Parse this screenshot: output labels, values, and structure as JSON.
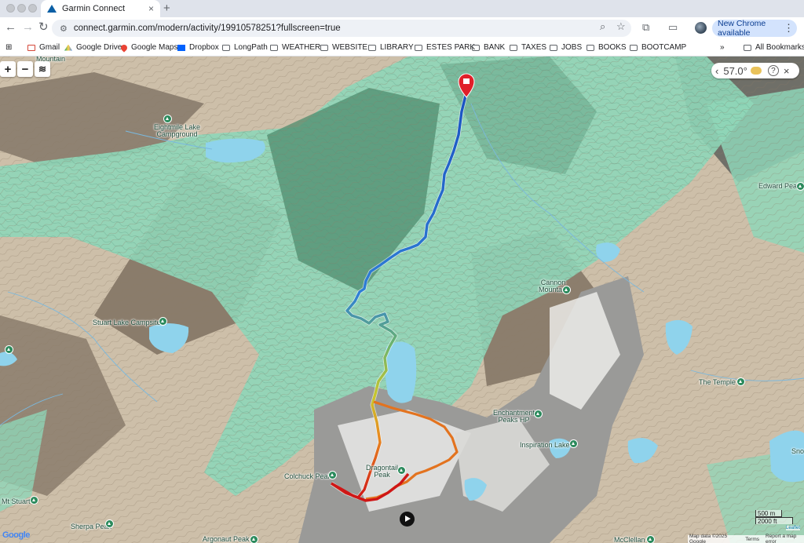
{
  "browser": {
    "tab_title": "Garmin Connect",
    "tab_close": "×",
    "new_tab": "+",
    "url": "connect.garmin.com/modern/activity/19910578251?fullscreen=true",
    "update_button": "New Chrome available",
    "more_menu": "⋮"
  },
  "bookmarks": [
    {
      "label": "Gmail",
      "icon": "gmail-icon"
    },
    {
      "label": "Google Drive",
      "icon": "google-drive-icon"
    },
    {
      "label": "Google Maps",
      "icon": "google-maps-icon"
    },
    {
      "label": "Dropbox",
      "icon": "dropbox-icon"
    },
    {
      "label": "LongPath",
      "icon": "folder-icon"
    },
    {
      "label": "WEATHER",
      "icon": "folder-icon"
    },
    {
      "label": "WEBSITE",
      "icon": "folder-icon"
    },
    {
      "label": "LIBRARY",
      "icon": "folder-icon"
    },
    {
      "label": "ESTES PARK",
      "icon": "folder-icon"
    },
    {
      "label": "BANK",
      "icon": "folder-icon"
    },
    {
      "label": "TAXES",
      "icon": "folder-icon"
    },
    {
      "label": "JOBS",
      "icon": "folder-icon"
    },
    {
      "label": "BOOKS",
      "icon": "folder-icon"
    },
    {
      "label": "BOOTCAMP",
      "icon": "folder-icon"
    }
  ],
  "bookmarks_overflow": "»",
  "all_bookmarks": "All Bookmarks",
  "map": {
    "zoom_in": "+",
    "zoom_out": "−",
    "weather": {
      "temperature": "57.0°",
      "prev": "‹",
      "help": "?",
      "close": "×"
    },
    "labels": {
      "mountain_top": "Mountain",
      "eightmile": "Eightmile Lake\nCampground",
      "edward": "Edward Peak",
      "cannon": "Cannon\nMountain",
      "stuart": "Stuart Lake Campsites",
      "temple": "The Temple",
      "enchantment": "Enchantment\nPeaks HP",
      "inspiration": "Inspiration Lake",
      "colchuck": "Colchuck Peak",
      "dragontail": "Dragontail\nPeak",
      "mt_stuart": "Mt Stuart",
      "sherpa": "Sherpa Peak",
      "argonaut": "Argonaut Peak",
      "mcclellan": "McClellan",
      "sno": "Sno"
    },
    "scale_m": "500 m",
    "scale_ft": "2000 ft",
    "leaflet": "Leaflet",
    "attribution": [
      "Map data ©2025 Google",
      "Terms",
      "Report a map error"
    ],
    "google_logo": "Google"
  }
}
